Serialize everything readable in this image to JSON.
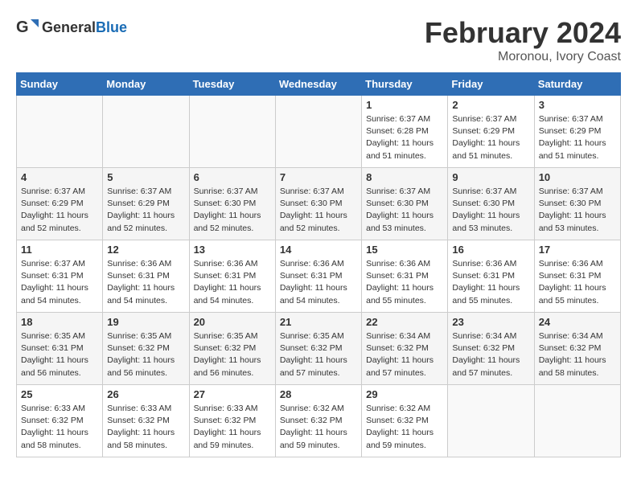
{
  "header": {
    "logo_general": "General",
    "logo_blue": "Blue",
    "title": "February 2024",
    "subtitle": "Moronou, Ivory Coast"
  },
  "days_of_week": [
    "Sunday",
    "Monday",
    "Tuesday",
    "Wednesday",
    "Thursday",
    "Friday",
    "Saturday"
  ],
  "weeks": [
    [
      {
        "day": "",
        "info": ""
      },
      {
        "day": "",
        "info": ""
      },
      {
        "day": "",
        "info": ""
      },
      {
        "day": "",
        "info": ""
      },
      {
        "day": "1",
        "info": "Sunrise: 6:37 AM\nSunset: 6:28 PM\nDaylight: 11 hours and 51 minutes."
      },
      {
        "day": "2",
        "info": "Sunrise: 6:37 AM\nSunset: 6:29 PM\nDaylight: 11 hours and 51 minutes."
      },
      {
        "day": "3",
        "info": "Sunrise: 6:37 AM\nSunset: 6:29 PM\nDaylight: 11 hours and 51 minutes."
      }
    ],
    [
      {
        "day": "4",
        "info": "Sunrise: 6:37 AM\nSunset: 6:29 PM\nDaylight: 11 hours and 52 minutes."
      },
      {
        "day": "5",
        "info": "Sunrise: 6:37 AM\nSunset: 6:29 PM\nDaylight: 11 hours and 52 minutes."
      },
      {
        "day": "6",
        "info": "Sunrise: 6:37 AM\nSunset: 6:30 PM\nDaylight: 11 hours and 52 minutes."
      },
      {
        "day": "7",
        "info": "Sunrise: 6:37 AM\nSunset: 6:30 PM\nDaylight: 11 hours and 52 minutes."
      },
      {
        "day": "8",
        "info": "Sunrise: 6:37 AM\nSunset: 6:30 PM\nDaylight: 11 hours and 53 minutes."
      },
      {
        "day": "9",
        "info": "Sunrise: 6:37 AM\nSunset: 6:30 PM\nDaylight: 11 hours and 53 minutes."
      },
      {
        "day": "10",
        "info": "Sunrise: 6:37 AM\nSunset: 6:30 PM\nDaylight: 11 hours and 53 minutes."
      }
    ],
    [
      {
        "day": "11",
        "info": "Sunrise: 6:37 AM\nSunset: 6:31 PM\nDaylight: 11 hours and 54 minutes."
      },
      {
        "day": "12",
        "info": "Sunrise: 6:36 AM\nSunset: 6:31 PM\nDaylight: 11 hours and 54 minutes."
      },
      {
        "day": "13",
        "info": "Sunrise: 6:36 AM\nSunset: 6:31 PM\nDaylight: 11 hours and 54 minutes."
      },
      {
        "day": "14",
        "info": "Sunrise: 6:36 AM\nSunset: 6:31 PM\nDaylight: 11 hours and 54 minutes."
      },
      {
        "day": "15",
        "info": "Sunrise: 6:36 AM\nSunset: 6:31 PM\nDaylight: 11 hours and 55 minutes."
      },
      {
        "day": "16",
        "info": "Sunrise: 6:36 AM\nSunset: 6:31 PM\nDaylight: 11 hours and 55 minutes."
      },
      {
        "day": "17",
        "info": "Sunrise: 6:36 AM\nSunset: 6:31 PM\nDaylight: 11 hours and 55 minutes."
      }
    ],
    [
      {
        "day": "18",
        "info": "Sunrise: 6:35 AM\nSunset: 6:31 PM\nDaylight: 11 hours and 56 minutes."
      },
      {
        "day": "19",
        "info": "Sunrise: 6:35 AM\nSunset: 6:32 PM\nDaylight: 11 hours and 56 minutes."
      },
      {
        "day": "20",
        "info": "Sunrise: 6:35 AM\nSunset: 6:32 PM\nDaylight: 11 hours and 56 minutes."
      },
      {
        "day": "21",
        "info": "Sunrise: 6:35 AM\nSunset: 6:32 PM\nDaylight: 11 hours and 57 minutes."
      },
      {
        "day": "22",
        "info": "Sunrise: 6:34 AM\nSunset: 6:32 PM\nDaylight: 11 hours and 57 minutes."
      },
      {
        "day": "23",
        "info": "Sunrise: 6:34 AM\nSunset: 6:32 PM\nDaylight: 11 hours and 57 minutes."
      },
      {
        "day": "24",
        "info": "Sunrise: 6:34 AM\nSunset: 6:32 PM\nDaylight: 11 hours and 58 minutes."
      }
    ],
    [
      {
        "day": "25",
        "info": "Sunrise: 6:33 AM\nSunset: 6:32 PM\nDaylight: 11 hours and 58 minutes."
      },
      {
        "day": "26",
        "info": "Sunrise: 6:33 AM\nSunset: 6:32 PM\nDaylight: 11 hours and 58 minutes."
      },
      {
        "day": "27",
        "info": "Sunrise: 6:33 AM\nSunset: 6:32 PM\nDaylight: 11 hours and 59 minutes."
      },
      {
        "day": "28",
        "info": "Sunrise: 6:32 AM\nSunset: 6:32 PM\nDaylight: 11 hours and 59 minutes."
      },
      {
        "day": "29",
        "info": "Sunrise: 6:32 AM\nSunset: 6:32 PM\nDaylight: 11 hours and 59 minutes."
      },
      {
        "day": "",
        "info": ""
      },
      {
        "day": "",
        "info": ""
      }
    ]
  ]
}
